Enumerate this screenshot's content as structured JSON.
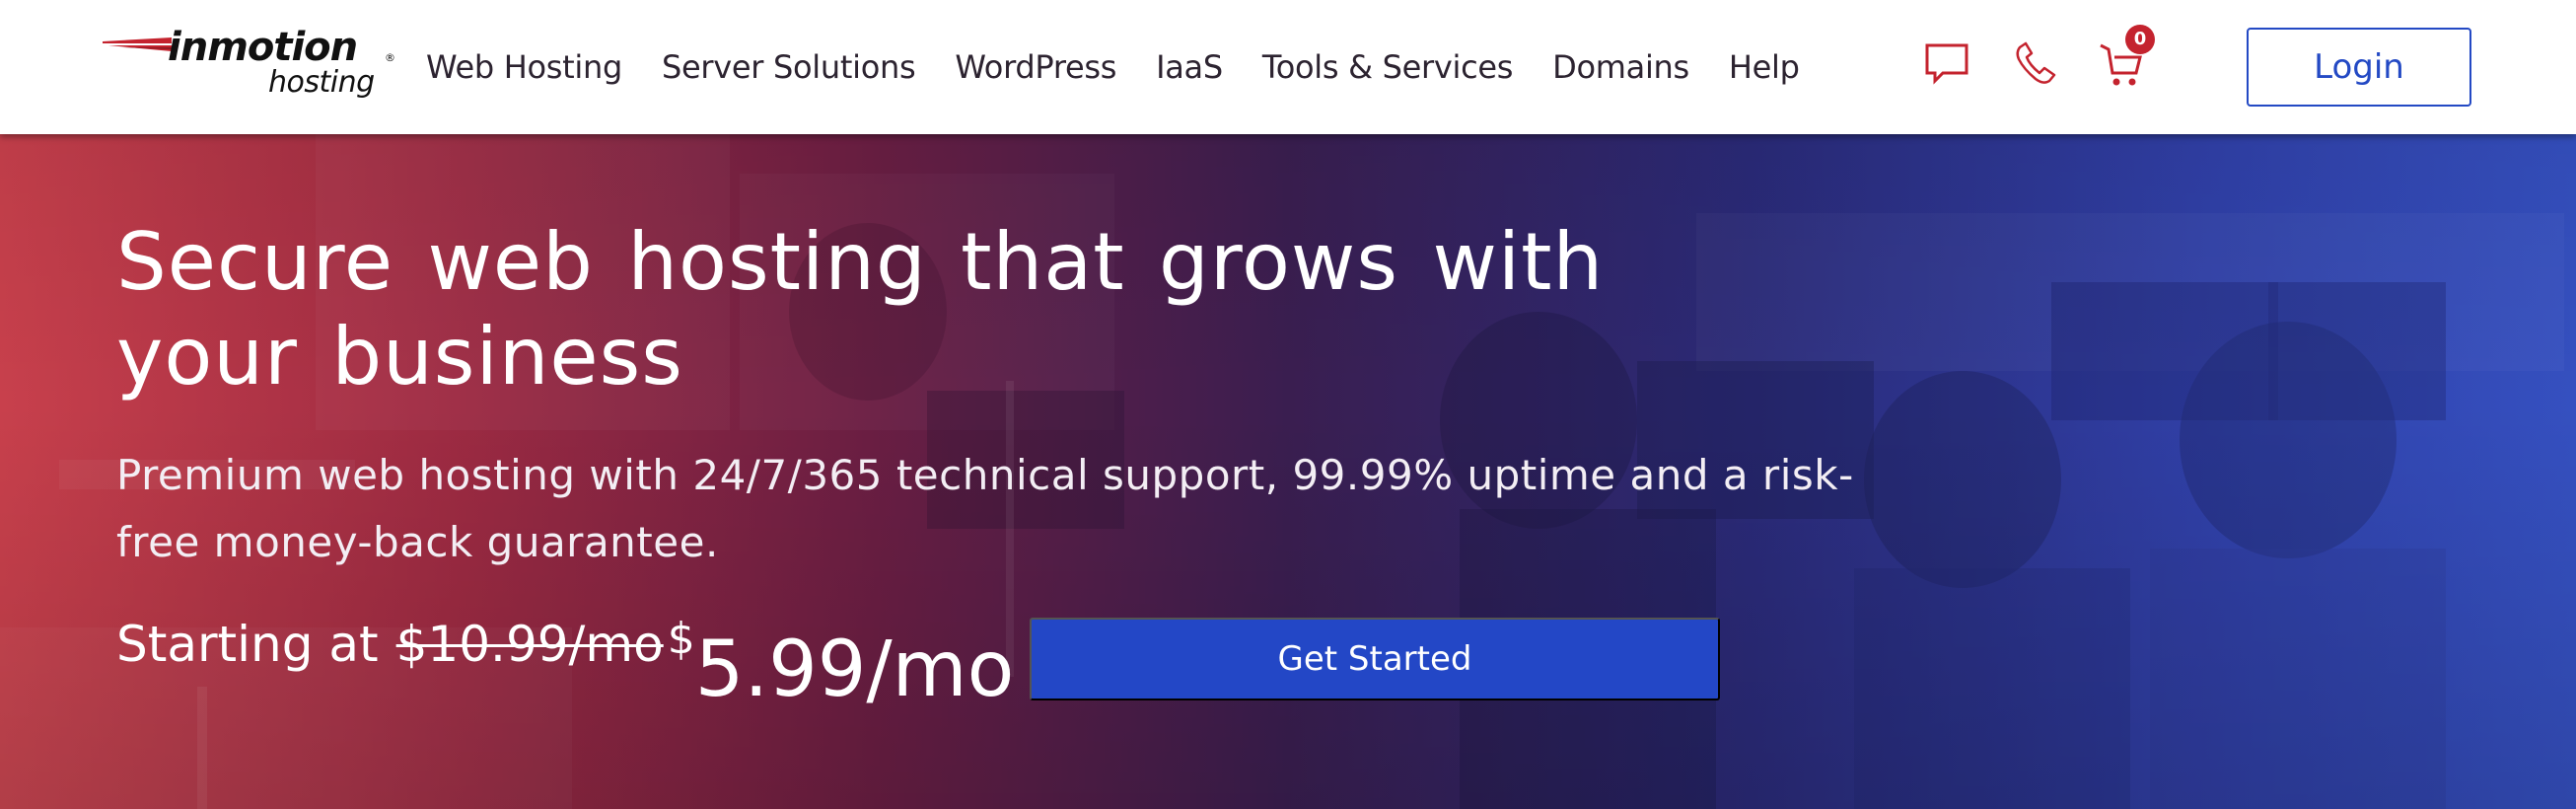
{
  "brand": {
    "name": "inmotion",
    "subname": "hosting",
    "registered_mark": "®",
    "logo_icon": "swoosh-logo-icon"
  },
  "nav": {
    "items": [
      {
        "label": "Web Hosting"
      },
      {
        "label": "Server Solutions"
      },
      {
        "label": "WordPress"
      },
      {
        "label": "IaaS"
      },
      {
        "label": "Tools & Services"
      },
      {
        "label": "Domains"
      },
      {
        "label": "Help"
      }
    ]
  },
  "utility": {
    "chat_icon": "chat-bubble-icon",
    "phone_icon": "phone-icon",
    "cart_icon": "shopping-cart-icon",
    "cart_count": "0",
    "login_label": "Login"
  },
  "hero": {
    "title": "Secure web hosting that grows with your business",
    "subtitle": "Premium web hosting with 24/7/365 technical support, 99.99% uptime and a risk-free money-back guarantee.",
    "price_lead": "Starting at",
    "price_old": "$10.99/mo",
    "price_currency": "$",
    "price_new": "5.99/mo",
    "cta_label": "Get Started",
    "background": "office-team-photo"
  },
  "colors": {
    "brand_red": "#c4232e",
    "brand_blue": "#2349c4",
    "cta_blue": "#2347c6",
    "nav_text": "#2c2330"
  }
}
